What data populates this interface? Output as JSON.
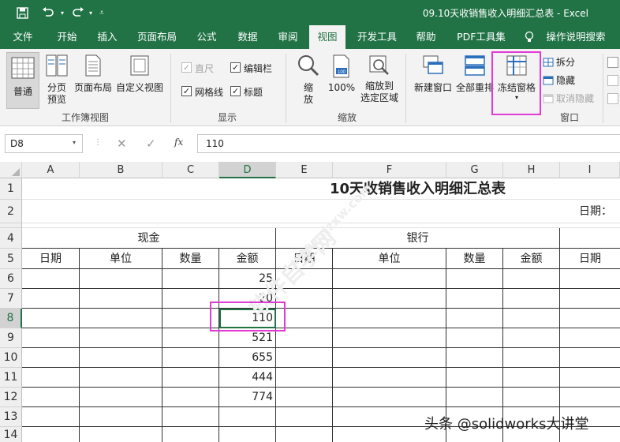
{
  "titlebar": {
    "title": "09.10天收销售收入明细汇总表  -  Excel",
    "save_icon": "save-icon",
    "undo_icon": "undo-icon",
    "redo_icon": "redo-icon",
    "customize_icon": "customize-qat-icon"
  },
  "tabs": [
    "文件",
    "开始",
    "插入",
    "页面布局",
    "公式",
    "数据",
    "审阅",
    "视图",
    "开发工具",
    "帮助",
    "PDF工具集",
    "操作说明搜索"
  ],
  "active_tab": "视图",
  "ribbon": {
    "workbook_views": {
      "label": "工作簿视图",
      "normal": "普通",
      "page_break": "分页\n预览",
      "page_layout": "页面布局",
      "custom_views": "自定义视图"
    },
    "show": {
      "label": "显示",
      "ruler": "直尺",
      "formula_bar": "编辑栏",
      "gridlines": "网格线",
      "headings": "标题"
    },
    "zoom": {
      "label": "缩放",
      "zoom": "缩\n放",
      "zoom100": "100%",
      "zoom_selection": "缩放到\n选定区域"
    },
    "window": {
      "label": "窗口",
      "new_window": "新建窗口",
      "arrange_all": "全部重排",
      "freeze_panes": "冻结窗格",
      "split": "拆分",
      "hide": "隐藏",
      "unhide": "取消隐藏"
    }
  },
  "formula_bar": {
    "name_box": "D8",
    "fx": "fx",
    "value": "110"
  },
  "columns": [
    "A",
    "B",
    "C",
    "D",
    "E",
    "F",
    "G",
    "H",
    "I"
  ],
  "rows": [
    "1",
    "2",
    "4",
    "5",
    "6",
    "7",
    "8",
    "9",
    "10",
    "11",
    "12",
    "13",
    "14"
  ],
  "sheet": {
    "title": "10天收销售收入明细汇总表",
    "date_label": "日期：",
    "cash": "现金",
    "bank": "银行",
    "headers": [
      "日期",
      "单位",
      "数量",
      "金额",
      "日期",
      "单位",
      "数量",
      "金额",
      "日期"
    ],
    "amounts": [
      "25",
      "20",
      "110",
      "521",
      "655",
      "444",
      "774"
    ]
  },
  "watermark": "头条 @solidworks大讲堂",
  "colors": {
    "excel_green": "#217346",
    "highlight": "#e13bd7"
  }
}
